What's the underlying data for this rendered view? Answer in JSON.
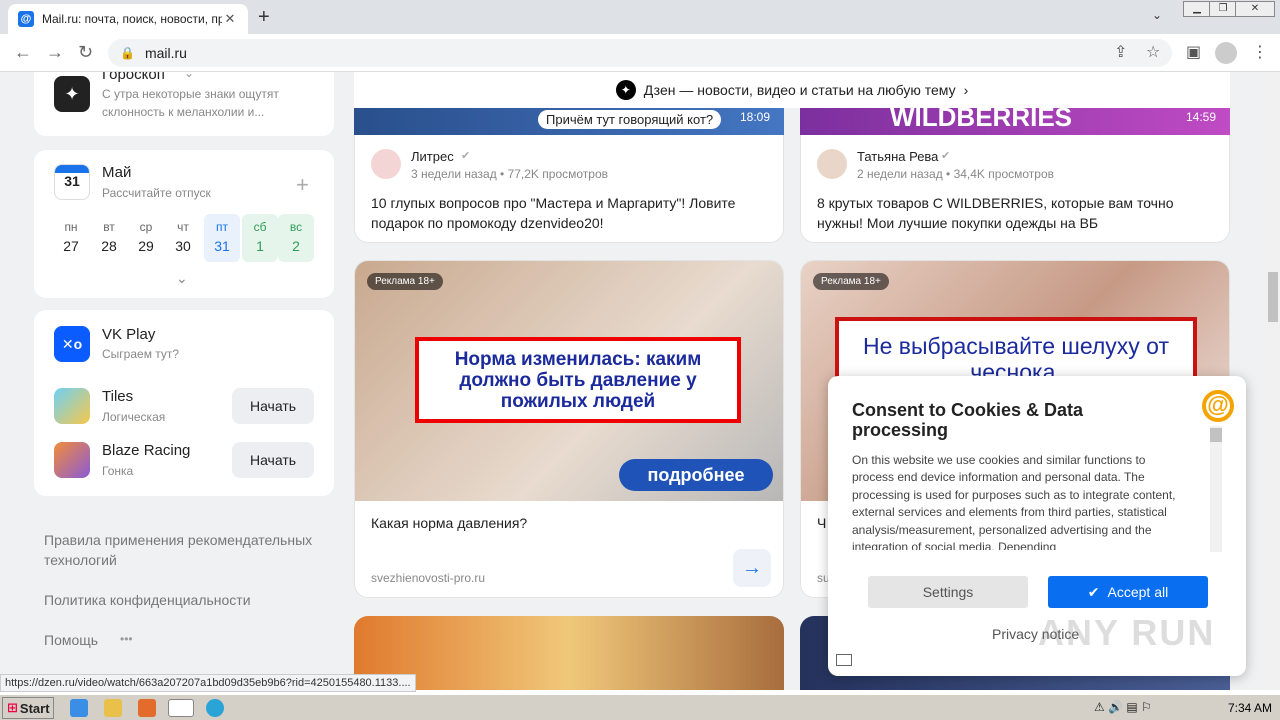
{
  "browser": {
    "tab_title": "Mail.ru: почта, поиск, новости, пр",
    "url": "mail.ru",
    "status_url": "https://dzen.ru/video/watch/663a207207a1bd09d35eb9b6?rid=4250155480.1133...."
  },
  "sidebar": {
    "horoscope": {
      "title": "Гороскоп",
      "text": "С утра некоторые знаки ощутят склонность к меланхолии и..."
    },
    "calendar": {
      "icon_day": "31",
      "title": "Май",
      "subtitle": "Рассчитайте отпуск",
      "days": [
        {
          "name": "пн",
          "num": "27"
        },
        {
          "name": "вт",
          "num": "28"
        },
        {
          "name": "ср",
          "num": "29"
        },
        {
          "name": "чт",
          "num": "30"
        },
        {
          "name": "пт",
          "num": "31"
        },
        {
          "name": "сб",
          "num": "1"
        },
        {
          "name": "вс",
          "num": "2"
        }
      ]
    },
    "vkplay": {
      "title": "VK Play",
      "subtitle": "Сыграем тут?",
      "games": [
        {
          "name": "Tiles",
          "genre": "Логическая",
          "button": "Начать"
        },
        {
          "name": "Blaze Racing",
          "genre": "Гонка",
          "button": "Начать"
        }
      ]
    },
    "footer": {
      "rules": "Правила применения рекомендательных технологий",
      "privacy": "Политика конфиденциальности",
      "help": "Помощь",
      "more": "•••"
    }
  },
  "feed": {
    "dzen_banner": "Дзен — новости, видео и статьи на любую тему",
    "videos": [
      {
        "overlay": "Причём тут говорящий кот?",
        "duration": "18:09",
        "author": "Литрес",
        "meta": "3 недели назад • 77,2K просмотров",
        "title": "10 глупых вопросов про \"Мастера и Маргариту\"! Ловите подарок по промокоду dzenvideo20!"
      },
      {
        "overlay": "WILDBERRIES",
        "duration": "14:59",
        "author": "Татьяна Рева",
        "meta": "2 недели назад • 34,4K просмотров",
        "title": "8 крутых товаров С WILDBERRIES, которые вам точно нужны! Мои лучшие покупки одежды на ВБ"
      }
    ],
    "ads": [
      {
        "badge": "Реклама 18+",
        "image_text": "Норма изменилась: каким должно быть давление у пожилых людей",
        "button": "подробнее",
        "title": "Какая норма давления?",
        "domain": "svezhienovosti-pro.ru"
      },
      {
        "badge": "Реклама 18+",
        "image_text": "Не выбрасывайте шелуху от чеснока.",
        "title": "Ч",
        "domain": "su"
      }
    ]
  },
  "consent": {
    "title": "Consent to Cookies & Data processing",
    "body": "On this website we use cookies and similar functions to process end device information and personal data. The processing is used for purposes such as to integrate content, external services and elements from third parties, statistical analysis/measurement, personalized advertising and the integration of social media. Depending",
    "settings": "Settings",
    "accept": "Accept all",
    "privacy": "Privacy notice"
  },
  "taskbar": {
    "start": "Start",
    "clock": "7:34 AM"
  },
  "watermark": "ANY RUN",
  "colors": {
    "accent": "#0a6ef0",
    "brand": "#1a73e8"
  }
}
